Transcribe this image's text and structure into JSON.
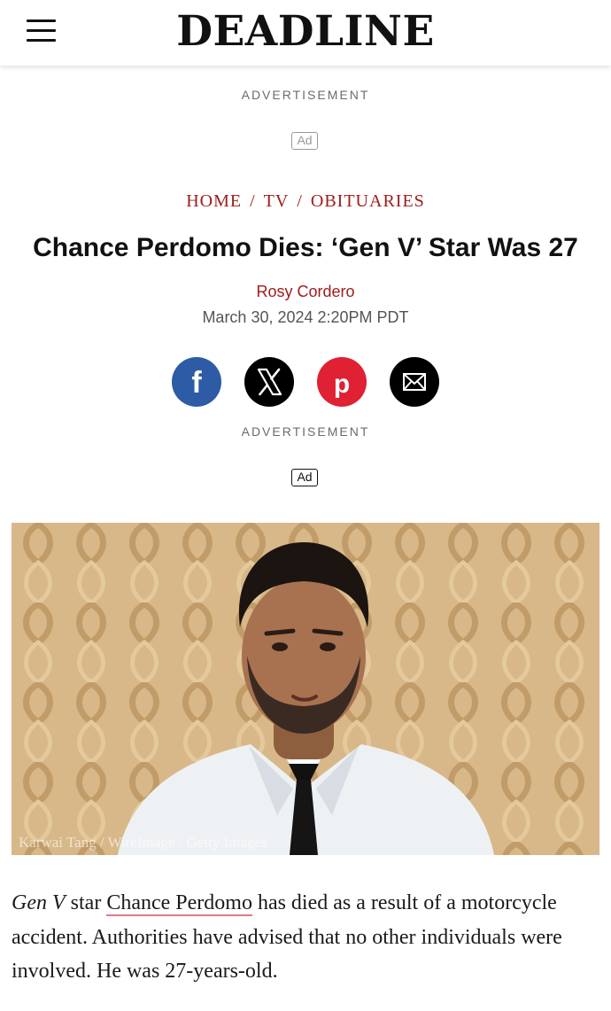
{
  "header": {
    "logo": "DEADLINE",
    "menu_icon": "hamburger-menu-icon"
  },
  "ads": {
    "label": "ADVERTISEMENT",
    "badge": "Ad"
  },
  "breadcrumb": [
    "HOME",
    "TV",
    "OBITUARIES"
  ],
  "breadcrumb_separator": "/",
  "article": {
    "headline": "Chance Perdomo Dies: ‘Gen V’ Star Was 27",
    "author": "Rosy Cordero",
    "date": "March 30, 2024 2:20PM PDT",
    "photo_credit": "Karwai Tang / WireImage / Getty Images",
    "body": {
      "show_title": "Gen V",
      "text_1": " star ",
      "link": "Chance Perdomo",
      "text_2": " has died as a result of a motorcycle accident. Authorities have advised that no other individuals were involved. He was 27-years-old."
    }
  },
  "share": {
    "icons": [
      "facebook-icon",
      "x-icon",
      "pinterest-icon",
      "email-icon"
    ],
    "colors": {
      "facebook": "#2d5ba6",
      "x": "#000000",
      "pinterest": "#e02033",
      "email": "#000000"
    }
  },
  "colors": {
    "accent": "#a01c1c"
  }
}
